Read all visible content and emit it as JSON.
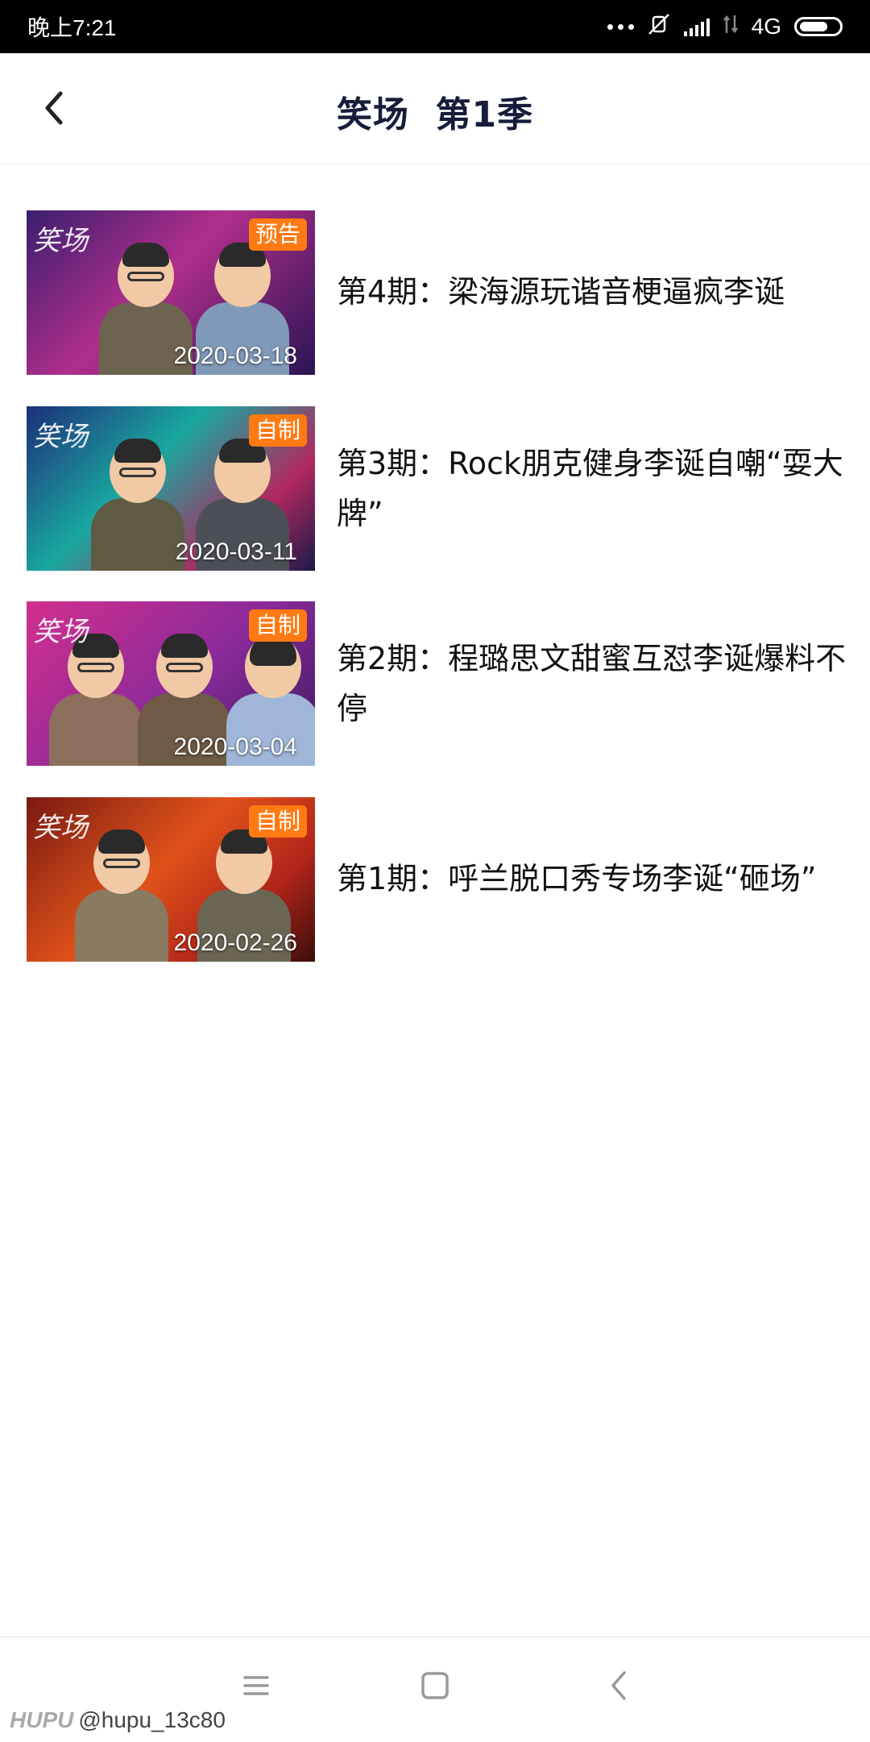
{
  "status_bar": {
    "time": "晚上7:21",
    "network": "4G",
    "icons": [
      "more-dots-icon",
      "mute-vibrate-icon",
      "signal-icon",
      "signal-2-icon",
      "battery-icon"
    ]
  },
  "header": {
    "back_icon": "chevron-left-icon",
    "title": "笑场  第1季"
  },
  "colors": {
    "badge": "#ff7a12",
    "title_text": "#161c3a"
  },
  "episodes": [
    {
      "title": "第4期：梁海源玩谐音梗逼疯李诞",
      "badge": "预告",
      "date": "2020-03-18",
      "logo": "笑场"
    },
    {
      "title": "第3期：Rock朋克健身李诞自嘲“耍大牌”",
      "badge": "自制",
      "date": "2020-03-11",
      "logo": "笑场"
    },
    {
      "title": "第2期：程璐思文甜蜜互怼李诞爆料不停",
      "badge": "自制",
      "date": "2020-03-04",
      "logo": "笑场"
    },
    {
      "title": "第1期：呼兰脱口秀专场李诞“砸场”",
      "badge": "自制",
      "date": "2020-02-26",
      "logo": "笑场"
    }
  ],
  "nav_bar": {
    "icons": [
      "menu-icon",
      "home-square-icon",
      "back-chevron-icon"
    ]
  },
  "watermark": {
    "brand": "HUPU",
    "user": "@hupu_13c80"
  }
}
